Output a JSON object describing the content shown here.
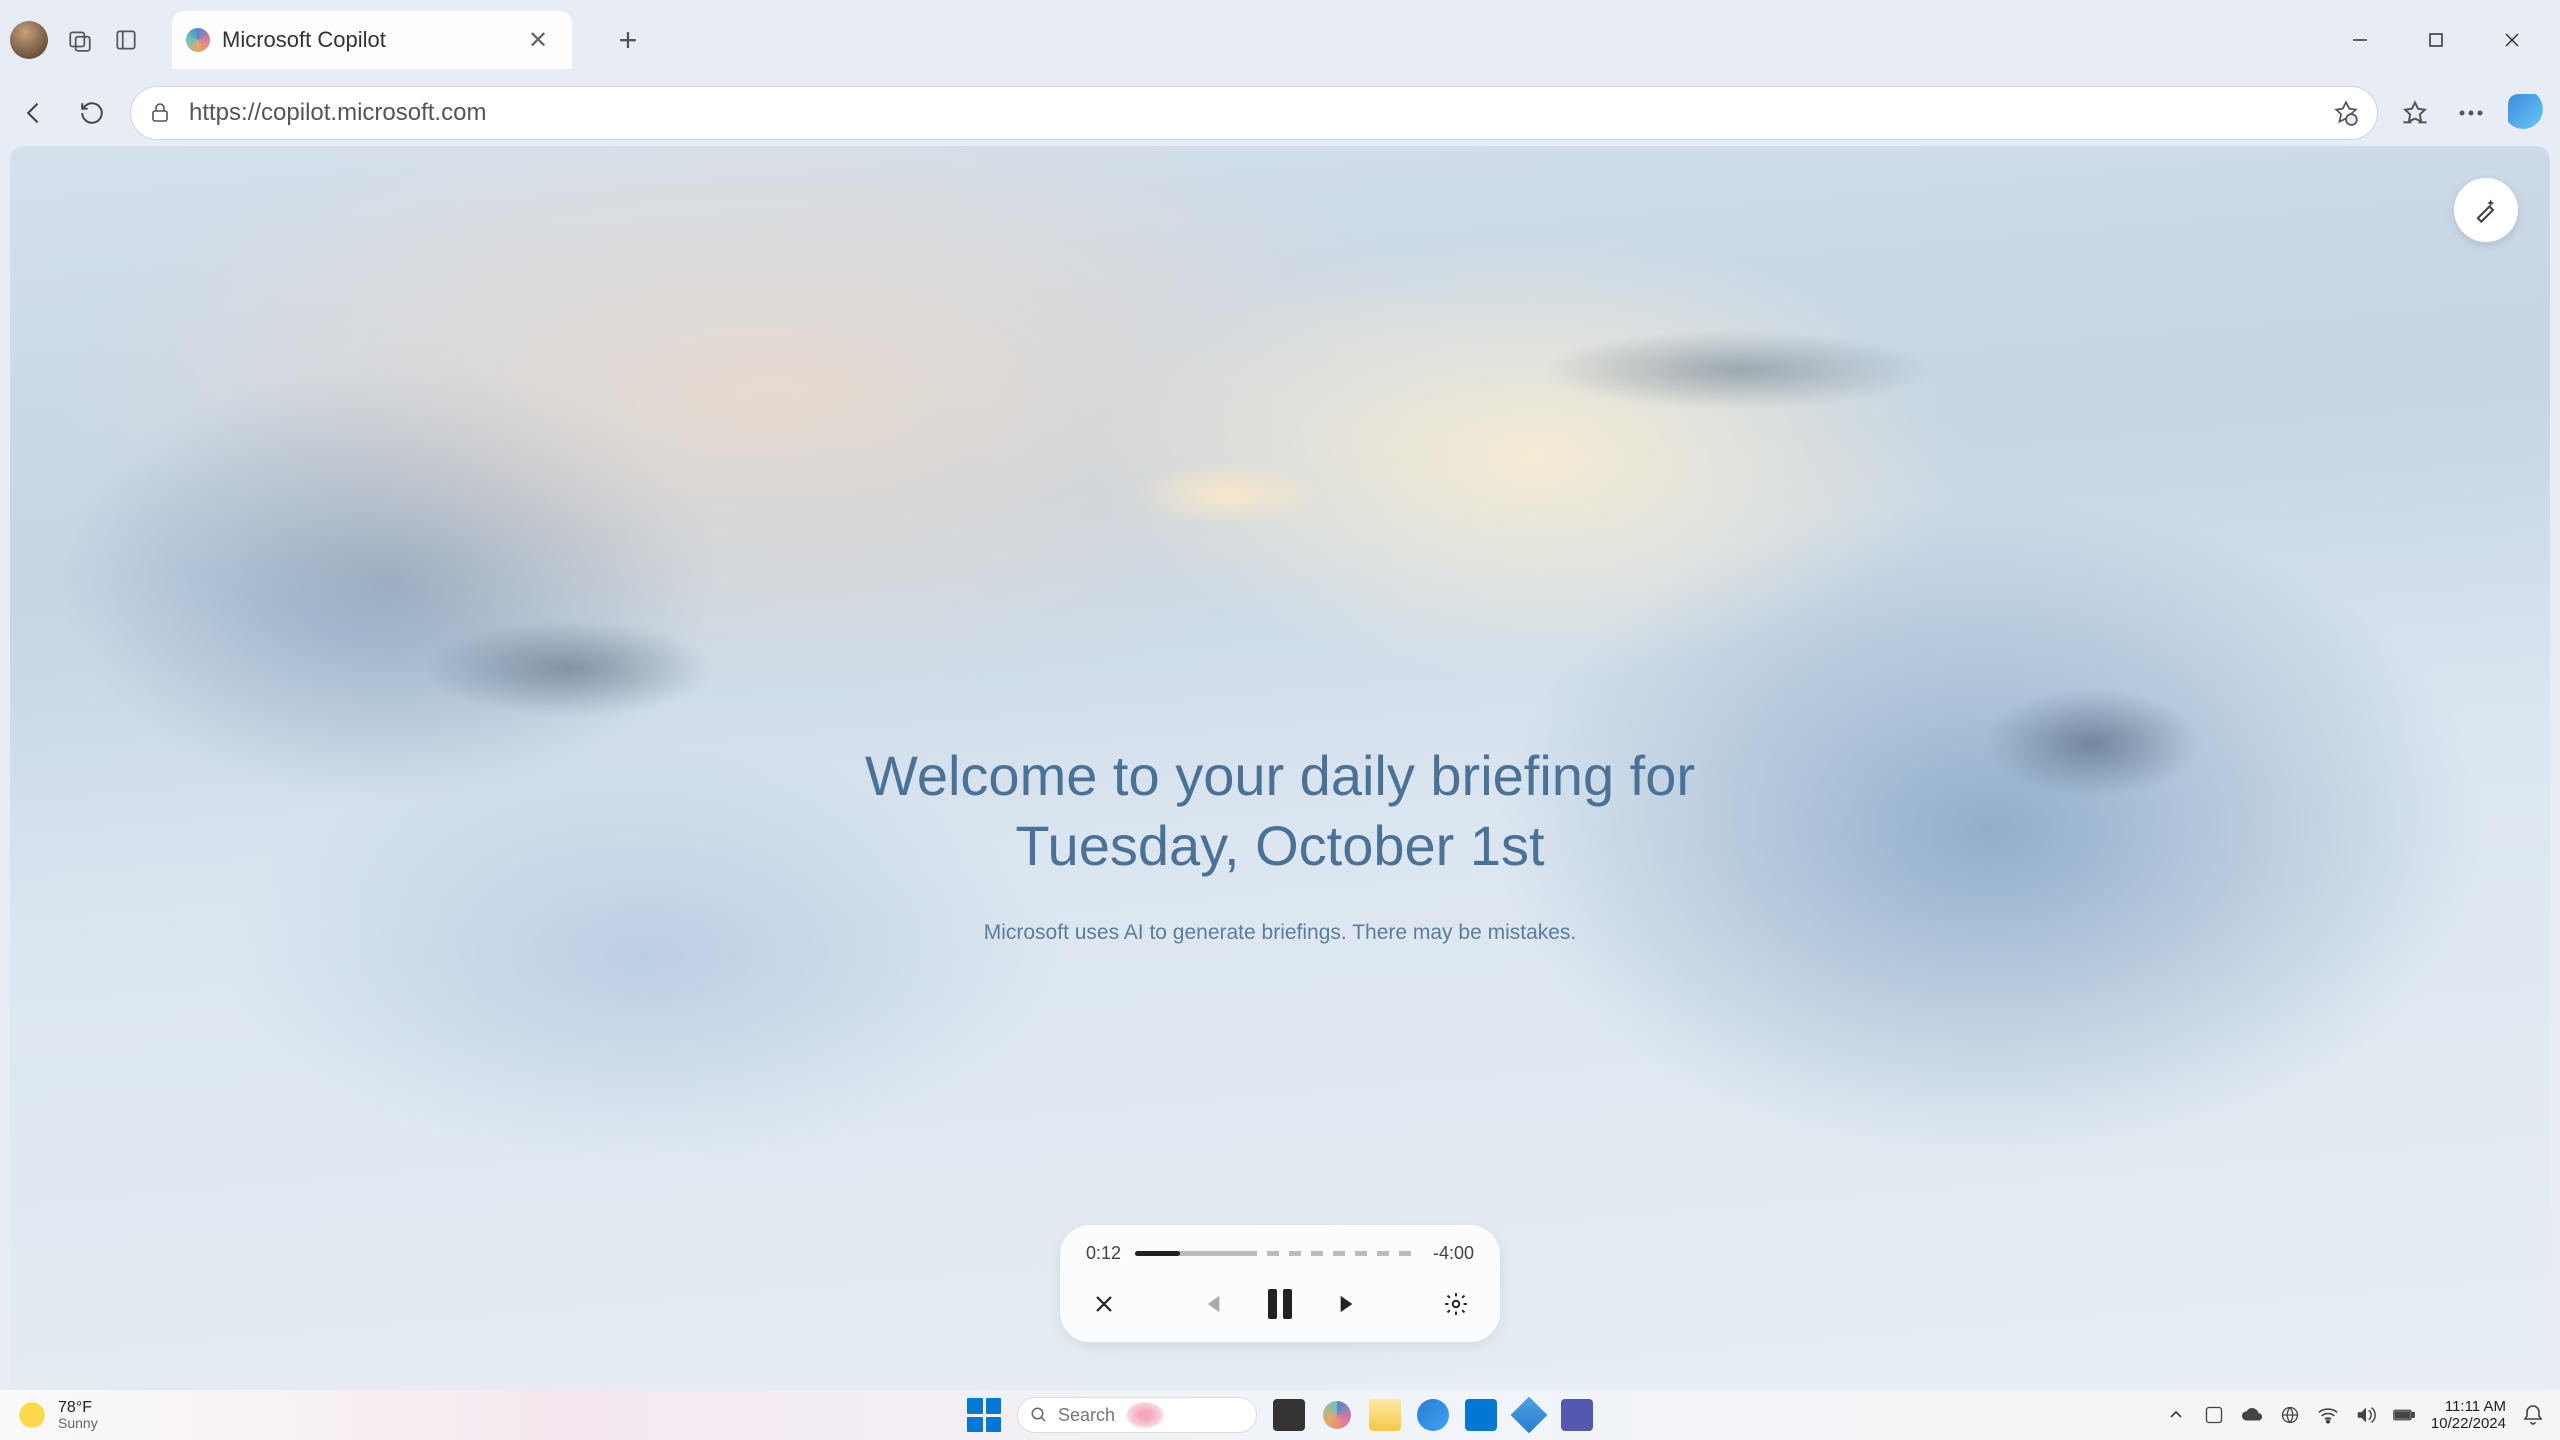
{
  "browser": {
    "tab_title": "Microsoft Copilot",
    "url": "https://copilot.microsoft.com"
  },
  "page": {
    "heading_line1": "Welcome to your daily briefing for",
    "heading_line2": "Tuesday, October 1st",
    "disclaimer": "Microsoft uses AI to generate briefings. There may be mistakes."
  },
  "player": {
    "elapsed": "0:12",
    "remaining": "-4:00",
    "progress_percent": 5
  },
  "taskbar": {
    "weather_temp": "78°F",
    "weather_cond": "Sunny",
    "search_placeholder": "Search",
    "time": "11:11 AM",
    "date": "10/22/2024"
  }
}
